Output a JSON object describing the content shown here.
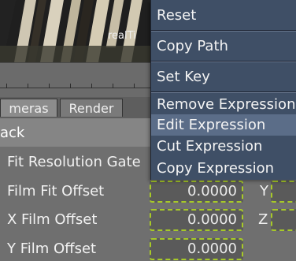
{
  "viewport": {
    "label": "realTi"
  },
  "tabs": [
    {
      "label": "meras"
    },
    {
      "label": "Render"
    }
  ],
  "panel": {
    "title": "ack"
  },
  "attributes": {
    "fit_resolution_gate": {
      "label": "Fit Resolution Gate"
    },
    "film_fit_offset": {
      "label": "Film Fit Offset",
      "value": "0.0000",
      "axis": "Y"
    },
    "x_film_offset": {
      "label": "X Film Offset",
      "value": "0.0000",
      "axis": "Z"
    },
    "y_film_offset": {
      "label": "Y Film Offset",
      "value": "0.0000"
    }
  },
  "context_menu": {
    "items": [
      {
        "label": "Reset"
      },
      {
        "label": "Copy Path"
      },
      {
        "label": "Set Key"
      },
      {
        "label": "Remove Expression"
      },
      {
        "label": "Edit Expression"
      },
      {
        "label": "Cut Expression"
      },
      {
        "label": "Copy Expression"
      }
    ],
    "highlighted": "Edit Expression"
  },
  "colors": {
    "menu_bg": "#3f4f66",
    "menu_highlight": "#5b6d88",
    "field_border": "#a7c928",
    "panel_bg": "#6f6f6f"
  }
}
